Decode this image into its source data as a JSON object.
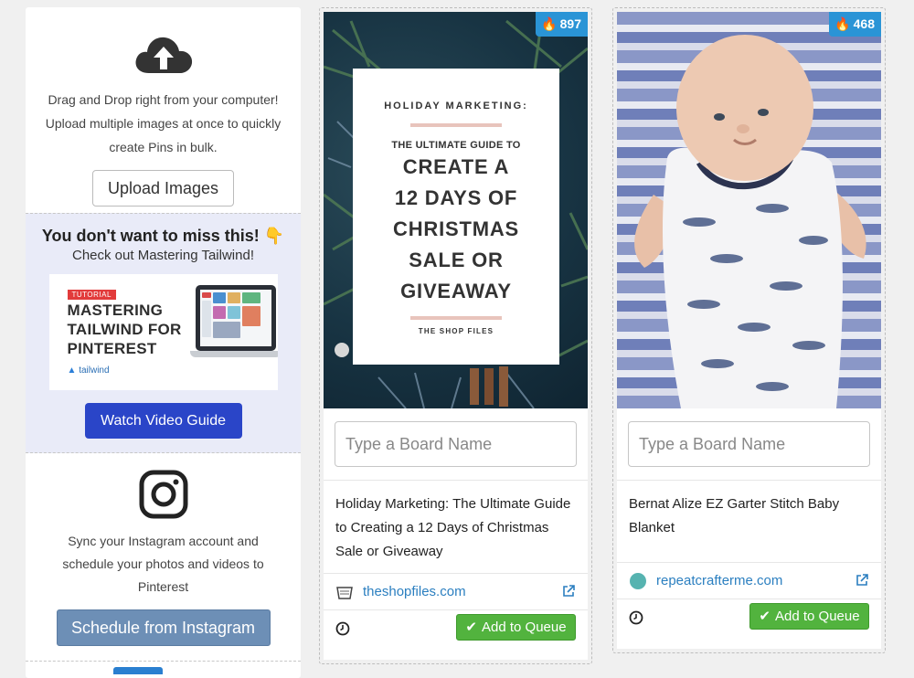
{
  "sidebar": {
    "upload": {
      "icon": "cloud-upload-icon",
      "description": "Drag and Drop right from your computer! Upload multiple images at once to quickly create Pins in bulk.",
      "button_label": "Upload Images"
    },
    "promo": {
      "title": "You don't want to miss this!",
      "emoji": "👇",
      "subtitle": "Check out Mastering Tailwind!",
      "thumbnail": {
        "tag": "TUTORIAL",
        "lines": [
          "MASTERING",
          "TAILWIND FOR",
          "PINTEREST"
        ],
        "logo": "tailwind"
      },
      "button_label": "Watch Video Guide"
    },
    "instagram": {
      "icon": "instagram-icon",
      "description": "Sync your Instagram account and schedule your photos and videos to Pinterest",
      "button_label": "Schedule from Instagram"
    }
  },
  "pins": [
    {
      "score": "897",
      "image": {
        "kicker": "HOLIDAY MARKETING:",
        "subtitle": "THE ULTIMATE GUIDE TO",
        "main_lines": [
          "CREATE A",
          "12 DAYS OF",
          "CHRISTMAS",
          "SALE OR",
          "GIVEAWAY"
        ],
        "brand": "THE SHOP FILES"
      },
      "board_placeholder": "Type a Board Name",
      "description": "Holiday Marketing: The Ultimate Guide to Creating a 12 Days of Christmas Sale or Giveaway",
      "source": "theshopfiles.com",
      "queue_label": "Add to Queue"
    },
    {
      "score": "468",
      "board_placeholder": "Type a Board Name",
      "description": "Bernat Alize EZ Garter Stitch Baby Blanket",
      "source": "repeatcrafterme.com",
      "queue_label": "Add to Queue"
    }
  ],
  "colors": {
    "score_badge": "#2a94d6",
    "queue_button": "#52b33e",
    "watch_button": "#2a45c8",
    "instagram_button": "#6d8fb6",
    "link": "#2b7fc0"
  }
}
